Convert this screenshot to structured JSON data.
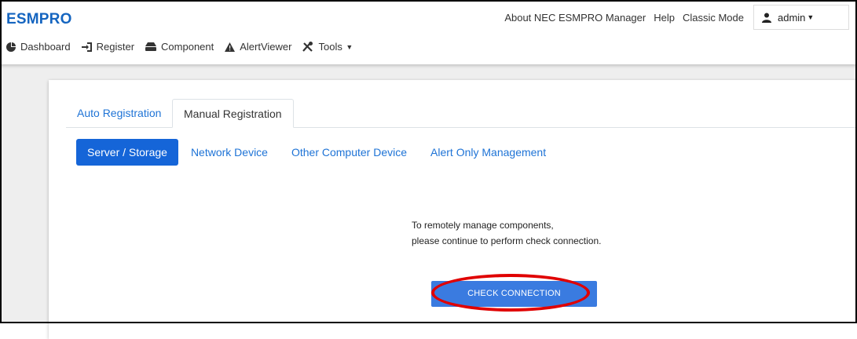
{
  "brand": "ESMPRO",
  "header": {
    "links": [
      "About NEC ESMPRO Manager",
      "Help",
      "Classic Mode"
    ],
    "user": "admin"
  },
  "nav": {
    "items": [
      {
        "label": "Dashboard",
        "icon": "pie-chart-icon"
      },
      {
        "label": "Register",
        "icon": "sign-in-icon"
      },
      {
        "label": "Component",
        "icon": "hdd-icon"
      },
      {
        "label": "AlertViewer",
        "icon": "warning-triangle-icon"
      },
      {
        "label": "Tools",
        "icon": "tools-icon"
      }
    ]
  },
  "tabs": [
    "Auto Registration",
    "Manual Registration"
  ],
  "active_tab": "Manual Registration",
  "subtabs": [
    "Server / Storage",
    "Network Device",
    "Other Computer Device",
    "Alert Only Management"
  ],
  "active_subtab": "Server / Storage",
  "message": {
    "line1": "To remotely manage components,",
    "line2": "please continue to perform check connection."
  },
  "button_label": "CHECK CONNECTION",
  "colors": {
    "accent": "#1565d8",
    "button": "#3a7be0",
    "highlight": "#e00000"
  }
}
